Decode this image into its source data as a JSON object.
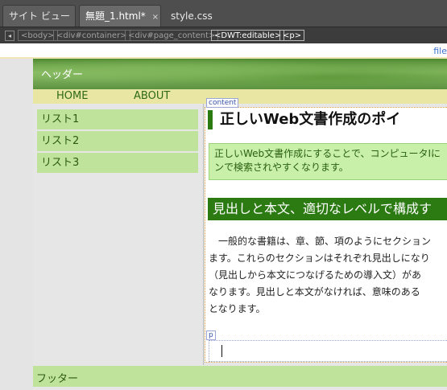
{
  "tabs": [
    {
      "label": "サイト ビュー"
    },
    {
      "label": "無題_1.html*",
      "close": "×"
    },
    {
      "label": "style.css"
    }
  ],
  "tag_selector": {
    "nav": "◂",
    "crumbs": [
      "<body>",
      "<div#container>",
      "<div#page_content>",
      "<DWT:editable>",
      "<p>"
    ]
  },
  "info_bar": {
    "file_label": "file"
  },
  "page": {
    "header": "ヘッダー",
    "nav": [
      "HOME",
      "ABOUT"
    ],
    "sidebar": [
      "リスト1",
      "リスト2",
      "リスト3"
    ],
    "content_tag": "content",
    "title": "正しいWeb文書作成のポイ",
    "intro": [
      "正しいWeb文書作成にすることで、コンピュータIに",
      "ンで検索されやすくなります。"
    ],
    "section_heading": "見出しと本文、適切なレベルで構成す",
    "body": [
      "　一般的な書籍は、章、節、項のようにセクション",
      "ます。これらのセクションはそれぞれ見出しになり",
      "（見出しから本文につなげるための導入文）があ",
      "なります。見出しと本文がなければ、意味のある",
      "となります。"
    ],
    "p_tag": "p",
    "footer": "フッター"
  },
  "colors": {
    "accent_green": "#2b7a12",
    "sidebar_bg": "#bfe39a",
    "nav_bg": "#e9e6a4",
    "tab_bar_bg": "#4e4e4e"
  }
}
